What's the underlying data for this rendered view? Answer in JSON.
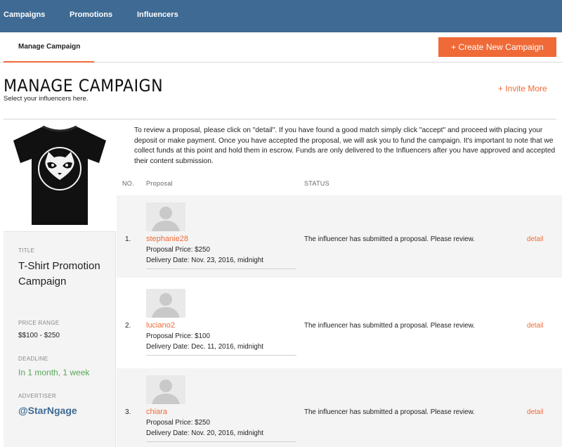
{
  "nav": {
    "items": [
      "Campaigns",
      "Promotions",
      "Influencers"
    ]
  },
  "subnav": {
    "active_tab": "Manage Campaign",
    "create_button": "+ Create New Campaign"
  },
  "header": {
    "title": "MANAGE CAMPAIGN",
    "subtitle": "Select your influencers here.",
    "invite_link": "+ Invite More"
  },
  "sidebar": {
    "title_label": "TITLE",
    "title_value": "T-Shirt Promotion Campaign",
    "price_label": "PRICE RANGE",
    "price_value": "$$100 - $250",
    "deadline_label": "DEADLINE",
    "deadline_value": "In 1 month, 1 week",
    "advertiser_label": "ADVERTISER",
    "advertiser_value": "@StarNgage"
  },
  "intro_text": "To review a proposal, please click on \"detail\". If you have found a good match simply click \"accept\" and proceed with placing your deposit or make payment. Once you have accepted the proposal, we will ask you to fund the campaign. It's important to note that we collect funds at this point and hold them in escrow. Funds are only delivered to the Influencers after you have approved and accepted their content submission.",
  "table": {
    "columns": [
      "NO.",
      "Proposal",
      "STATUS"
    ],
    "rows": [
      {
        "no": "1.",
        "name": "stephanie28",
        "price": "Proposal Price: $250",
        "delivery": "Delivery Date: Nov. 23, 2016, midnight",
        "status": "The influencer has submitted a proposal. Please review.",
        "action": "detail"
      },
      {
        "no": "2.",
        "name": "luciano2",
        "price": "Proposal Price: $100",
        "delivery": "Delivery Date: Dec. 11, 2016, midnight",
        "status": "The influencer has submitted a proposal. Please review.",
        "action": "detail"
      },
      {
        "no": "3.",
        "name": "chiara",
        "price": "Proposal Price: $250",
        "delivery": "Delivery Date: Nov. 20, 2016, midnight",
        "status": "The influencer has submitted a proposal. Please review.",
        "action": "detail"
      }
    ]
  },
  "colors": {
    "nav_bg": "#3e6a93",
    "accent": "#ef6a37",
    "deadline_green": "#5aa75a",
    "advertiser_blue": "#3e6a93",
    "row_alt_bg": "#f4f4f4"
  },
  "icons": {
    "avatar": "user-placeholder-icon",
    "product": "raccoon-tshirt-image"
  }
}
